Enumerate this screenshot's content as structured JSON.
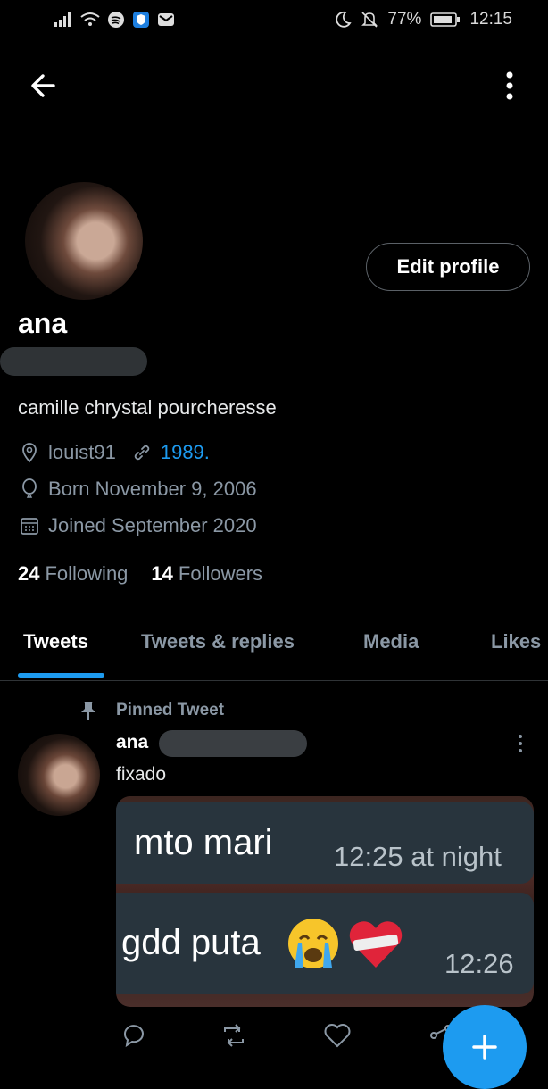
{
  "status_bar": {
    "battery": "77%",
    "time": "12:15",
    "icons": [
      "signal-icon",
      "wifi-icon",
      "spotify-icon",
      "shield-app-icon",
      "mail-icon",
      "moon-icon",
      "mute-icon",
      "battery-icon"
    ]
  },
  "header": {
    "back_icon": "arrow-left-icon",
    "more_icon": "more-vertical-icon"
  },
  "profile": {
    "display_name": "ana",
    "edit_label": "Edit profile",
    "bio": "camille chrystal pourcheresse",
    "location": "louist91",
    "link": "1989.",
    "birthday": "Born November 9, 2006",
    "joined": "Joined September 2020",
    "following_count": "24",
    "following_label": "Following",
    "followers_count": "14",
    "followers_label": "Followers"
  },
  "tabs": [
    {
      "label": "Tweets",
      "active": true
    },
    {
      "label": "Tweets & replies",
      "active": false
    },
    {
      "label": "Media",
      "active": false
    },
    {
      "label": "Likes",
      "active": false
    }
  ],
  "pinned_tweet": {
    "pinned_label": "Pinned Tweet",
    "author": "ana",
    "text": "fixado",
    "media": {
      "bubble1_text": "mto mari",
      "bubble1_time": "12:25 at night",
      "bubble2_text": "gdd puta",
      "bubble2_time": "12:26"
    }
  },
  "colors": {
    "accent": "#1d9bf0",
    "background": "#000000",
    "muted": "#8b98a5"
  }
}
